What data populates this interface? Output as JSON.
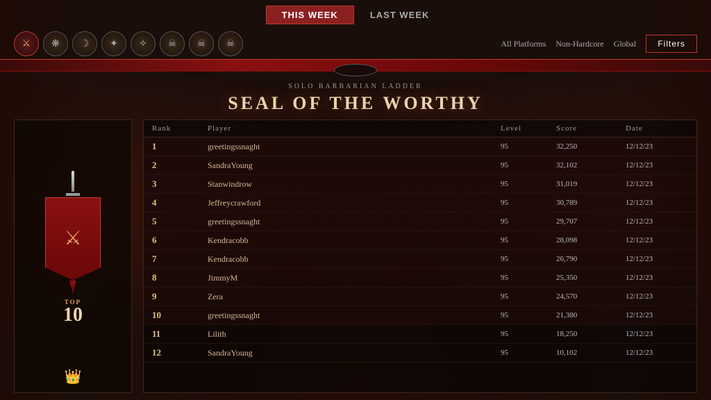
{
  "tabs": {
    "this_week": "THIS WEEK",
    "last_week": "LAST WEEK",
    "active": "this_week"
  },
  "class_icons": [
    {
      "id": "barbarian",
      "symbol": "⚔",
      "active": true
    },
    {
      "id": "druid",
      "symbol": "🌿",
      "active": false
    },
    {
      "id": "necromancer",
      "symbol": "💀",
      "active": false
    },
    {
      "id": "rogue",
      "symbol": "🗡",
      "active": false
    },
    {
      "id": "sorcerer",
      "symbol": "✦",
      "active": false
    },
    {
      "id": "skull1",
      "symbol": "☠",
      "active": false
    },
    {
      "id": "skull2",
      "symbol": "☠",
      "active": false
    },
    {
      "id": "skull3",
      "symbol": "☠",
      "active": false
    }
  ],
  "filters": {
    "platform": "All Platforms",
    "mode": "Non-Hardcore",
    "scope": "Global",
    "button_label": "Filters"
  },
  "ladder": {
    "subtitle": "Solo Barbarian Ladder",
    "title": "SEAL OF THE WORTHY"
  },
  "trophy": {
    "top_label": "TOP",
    "top_number": "10"
  },
  "table": {
    "headers": {
      "rank": "Rank",
      "player": "Player",
      "level": "Level",
      "score": "Score",
      "date": "Date"
    },
    "rows": [
      {
        "rank": "1",
        "player": "greetingssnaght",
        "level": "95",
        "score": "32,250",
        "date": "12/12/23"
      },
      {
        "rank": "2",
        "player": "SandraYoung",
        "level": "95",
        "score": "32,102",
        "date": "12/12/23"
      },
      {
        "rank": "3",
        "player": "Stanwindrow",
        "level": "95",
        "score": "31,019",
        "date": "12/12/23"
      },
      {
        "rank": "4",
        "player": "Jeffreycrawford",
        "level": "95",
        "score": "30,789",
        "date": "12/12/23"
      },
      {
        "rank": "5",
        "player": "greetingssnaght",
        "level": "95",
        "score": "29,707",
        "date": "12/12/23"
      },
      {
        "rank": "6",
        "player": "Kendracobb",
        "level": "95",
        "score": "28,098",
        "date": "12/12/23"
      },
      {
        "rank": "7",
        "player": "Kendracobb",
        "level": "95",
        "score": "26,790",
        "date": "12/12/23"
      },
      {
        "rank": "8",
        "player": "JimmyM",
        "level": "95",
        "score": "25,350",
        "date": "12/12/23"
      },
      {
        "rank": "9",
        "player": "Zera",
        "level": "95",
        "score": "24,570",
        "date": "12/12/23"
      },
      {
        "rank": "10",
        "player": "greetingssnaght",
        "level": "95",
        "score": "21,380",
        "date": "12/12/23"
      },
      {
        "rank": "11",
        "player": "Lilith",
        "level": "95",
        "score": "18,250",
        "date": "12/12/23"
      },
      {
        "rank": "12",
        "player": "SandraYoung",
        "level": "95",
        "score": "10,102",
        "date": "12/12/23"
      }
    ]
  }
}
